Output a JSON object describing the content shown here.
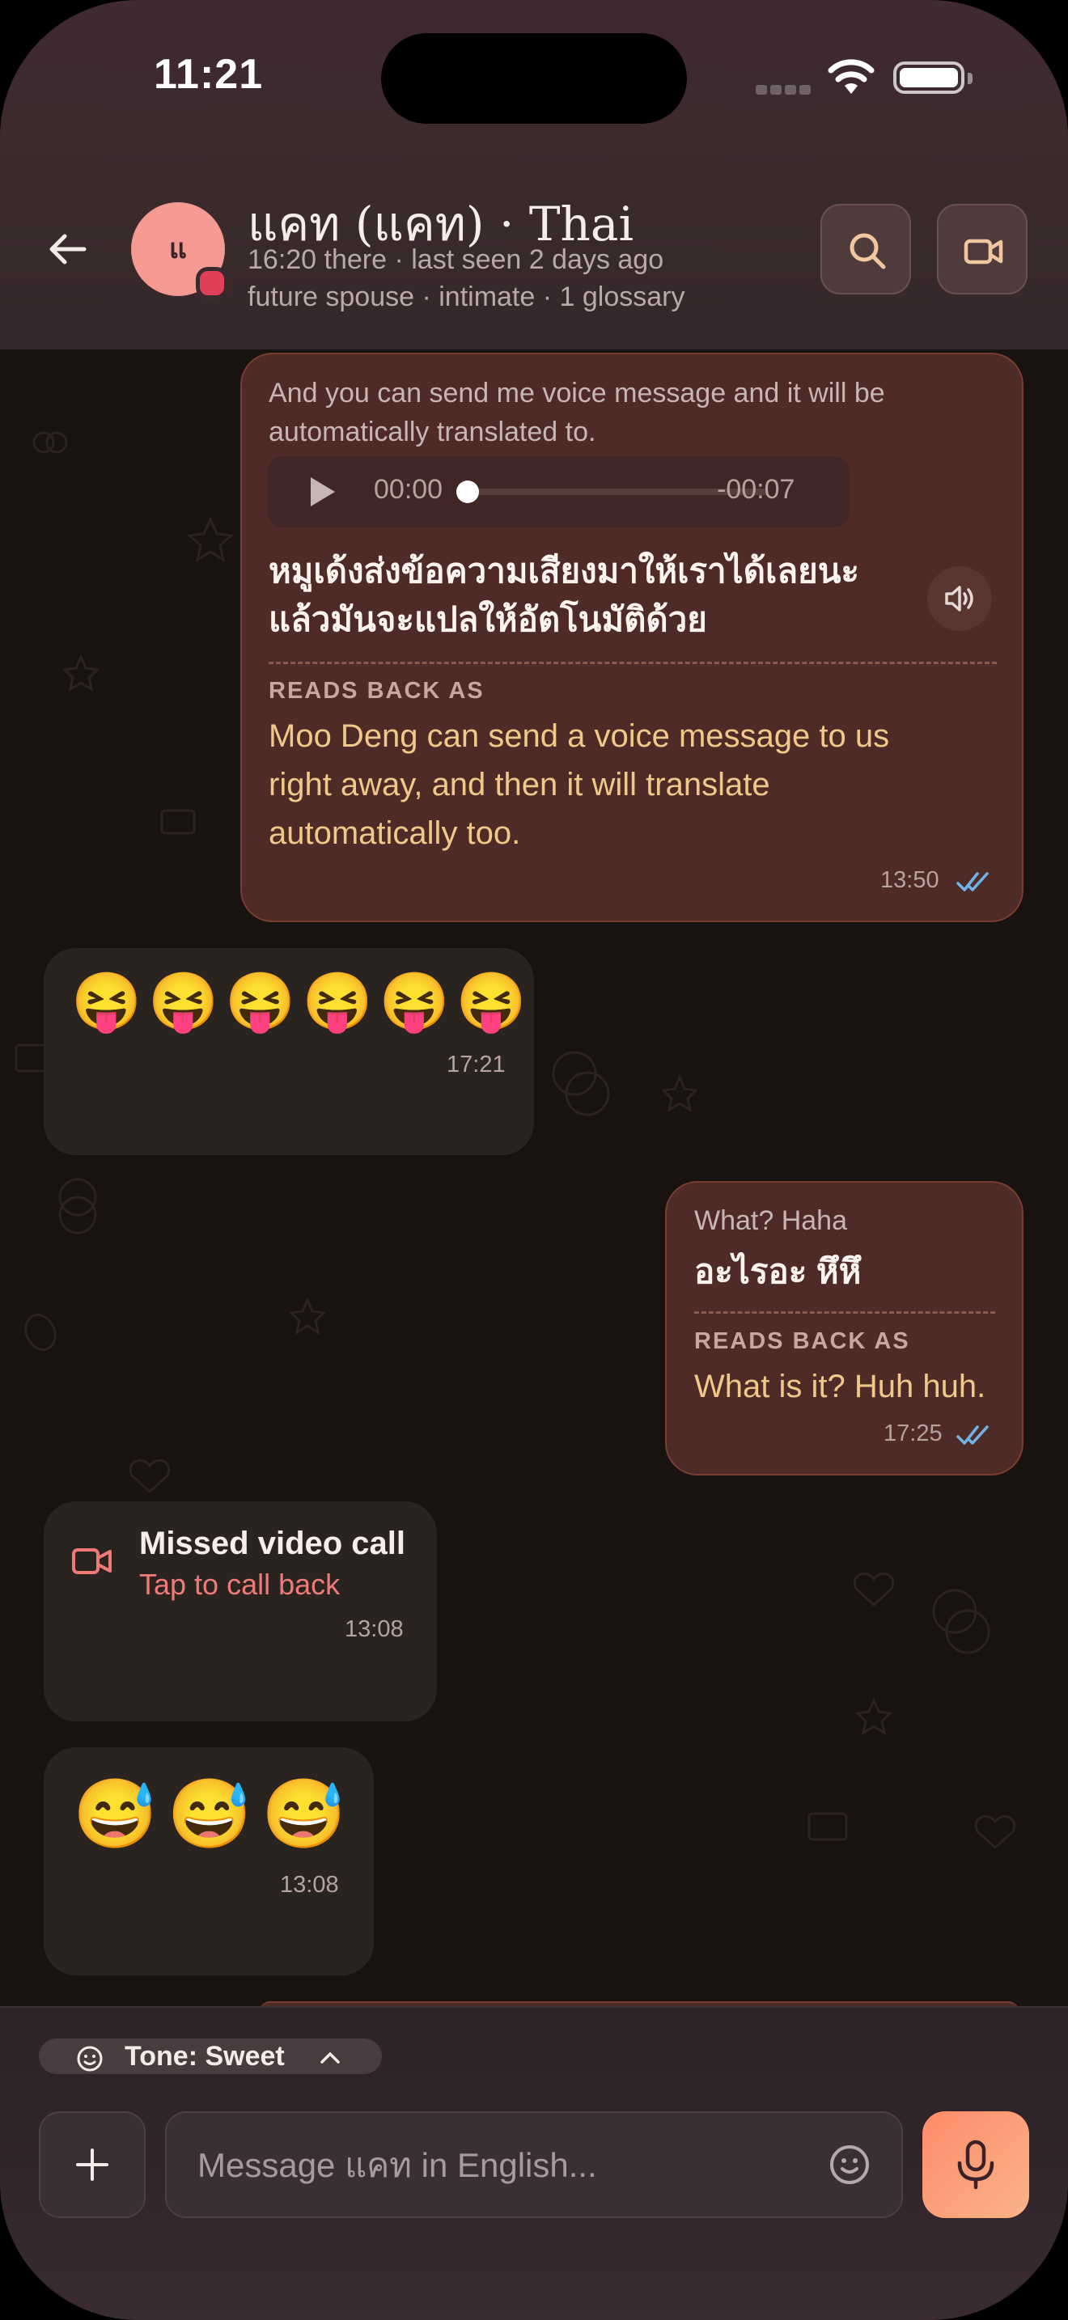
{
  "status_bar": {
    "time": "11:21"
  },
  "header": {
    "contact_name": "แคท (แคท) · Thai",
    "avatar_initials": "แ",
    "subtitle_line1": "16:20 there · last seen 2 days ago",
    "subtitle_line2": "future spouse · intimate · 1 glossary"
  },
  "messages": {
    "m1": {
      "source_text": "And you can send me voice message and it will be automatically translated to.",
      "voice_elapsed": "00:00",
      "voice_remaining": "-00:07",
      "thai_line1": "หมูเด้งส่งข้อความเสียงมาให้เราได้เลยนะ",
      "thai_line2": "แล้วมันจะแปลให้อัตโนมัติด้วย",
      "reads_back_label": "READS BACK AS",
      "translation_line1": "Moo Deng can send a voice message to us",
      "translation_line2": "right away, and then it will translate",
      "translation_line3": "automatically too.",
      "time": "13:50"
    },
    "m2": {
      "emojis": "😝😝😝😝😝😝",
      "time": "17:21"
    },
    "m3": {
      "source_text": "What? Haha",
      "thai": "อะไรอะ หึหึ",
      "reads_back_label": "READS BACK AS",
      "translation": "What is it? Huh huh.",
      "time": "17:25"
    },
    "m4": {
      "title": "Missed video call",
      "action": "Tap to call back",
      "time": "13:08"
    },
    "m5": {
      "emojis": "😅😅😅",
      "time": "13:08"
    }
  },
  "composer": {
    "tone_label": "Tone: Sweet",
    "placeholder": "Message แคท in English..."
  },
  "colors": {
    "accent": "#ff8a6a",
    "translation": "#f0c98a",
    "missed_call": "#f07a78",
    "read_ticks": "#6fb4e8"
  }
}
